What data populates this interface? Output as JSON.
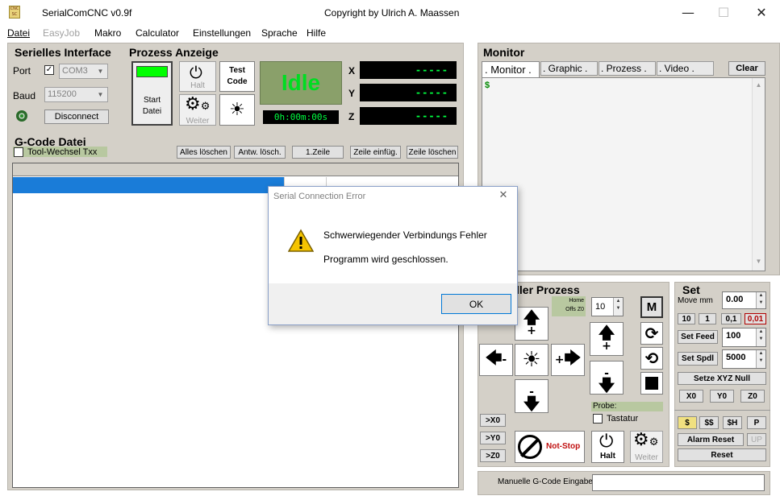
{
  "window": {
    "title": "SerialComCNC  v0.9f",
    "copyright": "Copyright by Ulrich A. Maassen",
    "minimize": "—",
    "maximize": "☐",
    "close": "✕"
  },
  "menu": [
    "Datei",
    "EasyJob",
    "Makro",
    "Calculator",
    "Einstellungen",
    "Sprache",
    "Hilfe"
  ],
  "serial": {
    "title": "Serielles Interface",
    "port_label": "Port",
    "port_value": "COM3",
    "port_checked": "✓",
    "baud_label": "Baud",
    "baud_value": "115200",
    "disconnect": "Disconnect"
  },
  "prozess": {
    "title": "Prozess Anzeige",
    "start_label": "Start\nDatei",
    "halt_label": "Halt",
    "weiter_label": "Weiter",
    "test_code": "Test\nCode",
    "state": "Idle",
    "timer": "0h:00m:00s",
    "axes": [
      {
        "name": "X",
        "value": "-----"
      },
      {
        "name": "Y",
        "value": "-----"
      },
      {
        "name": "Z",
        "value": "-----"
      }
    ]
  },
  "gcode": {
    "title": "G-Code Datei",
    "tool_change": "Tool-Wechsel Txx",
    "buttons": [
      "Alles löschen",
      "Antw. lösch.",
      "1.Zeile",
      "Zeile einfüg.",
      "Zeile löschen"
    ]
  },
  "monitor": {
    "title": "Monitor",
    "tabs": [
      ". Monitor .",
      ". Graphic .",
      ". Prozess .",
      ". Video ."
    ],
    "clear": "Clear",
    "prompt": "$"
  },
  "controller": {
    "title": "ller Prozess",
    "home_label": "Home",
    "offs_label": "Offs Z0",
    "step_value": "10",
    "m_button": "M",
    "goto_buttons": [
      ">X0",
      ">Y0",
      ">Z0"
    ],
    "notstop": "Not-Stop",
    "halt": "Halt",
    "weiter": "Weiter",
    "probe_label": "Probe:",
    "tastatur": "Tastatur"
  },
  "set": {
    "title": "Set",
    "move_label": "Move mm",
    "move_value": "0.00",
    "steps": [
      "10",
      "1",
      "0,1",
      "0,01"
    ],
    "feed_button": "Set Feed",
    "feed_value": "100",
    "spdl_button": "Set Spdl",
    "spdl_value": "5000",
    "zero_button": "Setze XYZ Null",
    "axis_zero": [
      "X0",
      "Y0",
      "Z0"
    ],
    "grbl_buttons": [
      "$",
      "$$",
      "$H",
      "P"
    ],
    "alarm_reset": "Alarm Reset",
    "up": "UP",
    "reset": "Reset"
  },
  "manual": {
    "label": "Manuelle G-Code Eingabe",
    "value": ""
  },
  "dialog": {
    "title": "Serial Connection Error",
    "line1": "Schwerwiegender Verbindungs Fehler",
    "line2": "Programm wird geschlossen.",
    "ok": "OK",
    "close": "✕"
  },
  "colors": {
    "panel": "#d4d0c8",
    "lcd_text": "#00ff40",
    "idle_green": "#00dd22",
    "selection_blue": "#1a7cd8"
  }
}
